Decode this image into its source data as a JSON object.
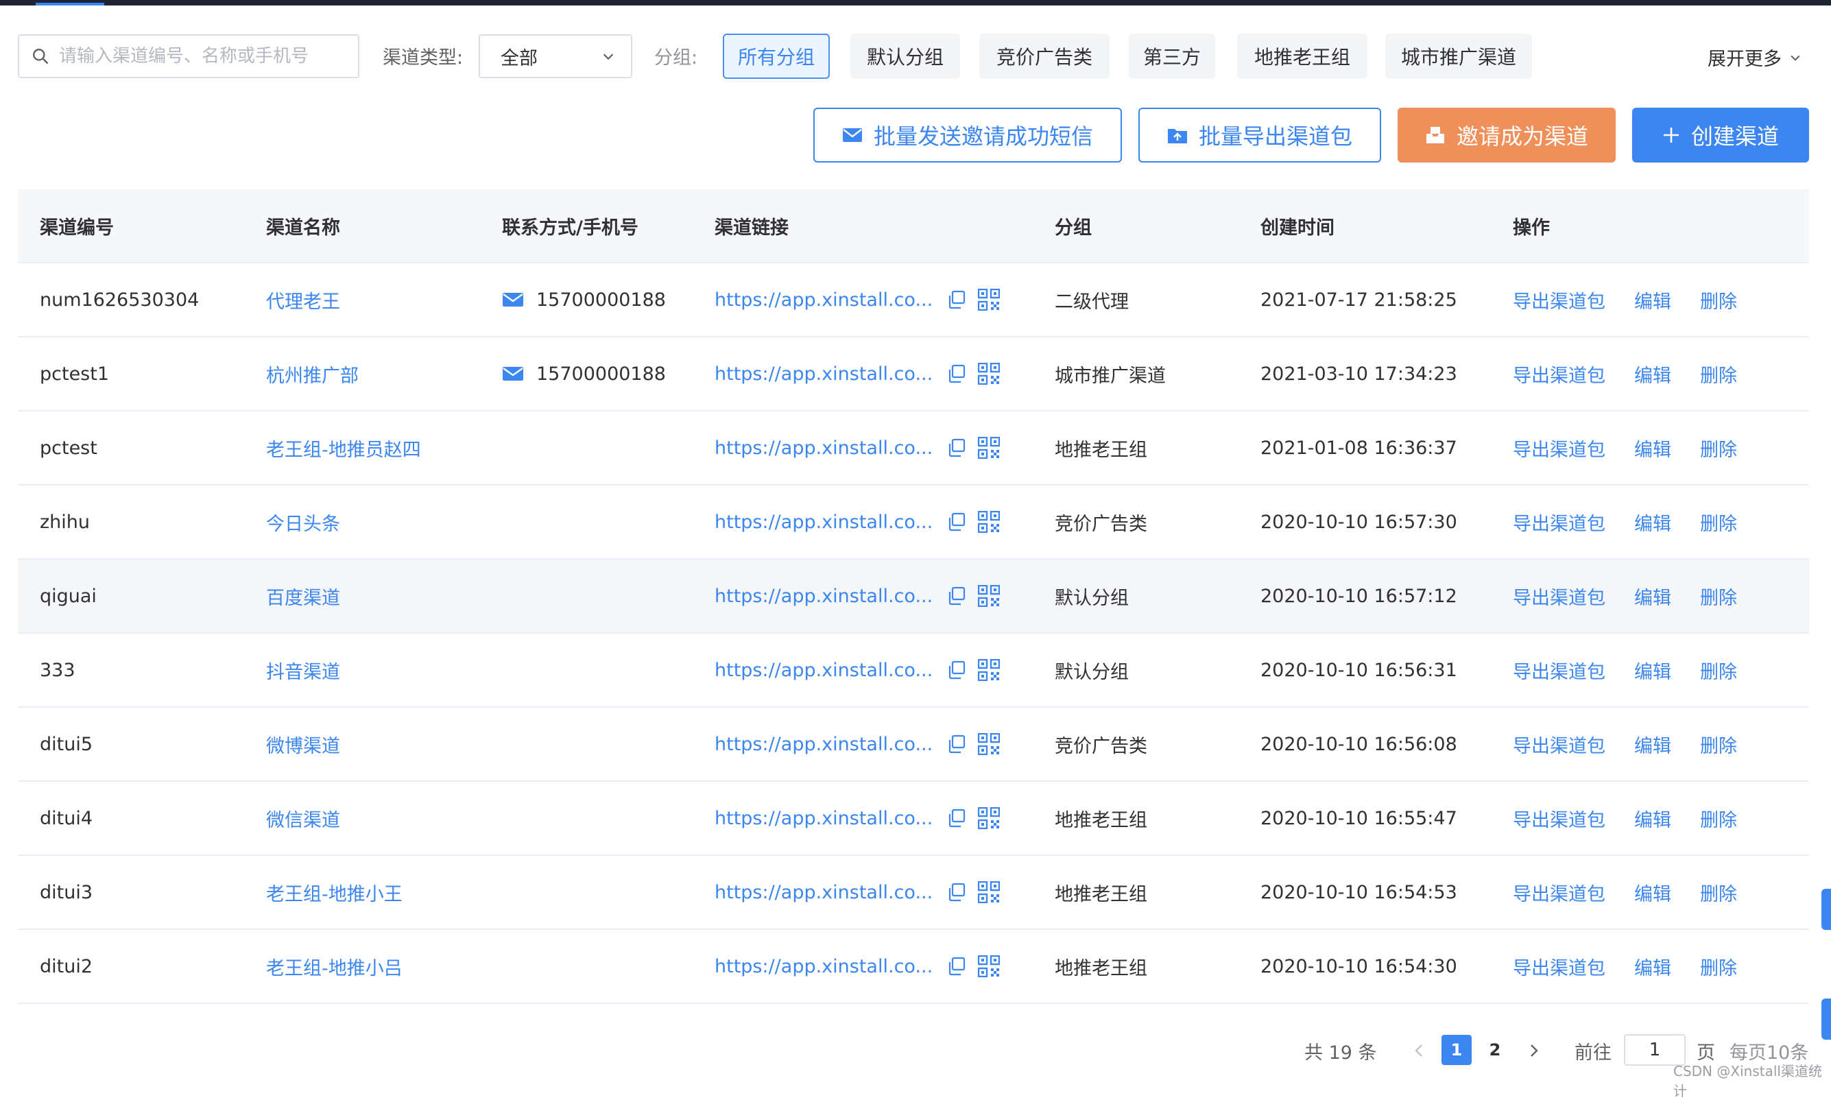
{
  "filters": {
    "search_placeholder": "请输入渠道编号、名称或手机号",
    "type_label": "渠道类型:",
    "type_value": "全部",
    "group_label": "分组:",
    "groups": [
      "所有分组",
      "默认分组",
      "竞价广告类",
      "第三方",
      "地推老王组",
      "城市推广渠道"
    ],
    "active_group": "所有分组",
    "more_label": "展开更多"
  },
  "actions": {
    "batch_sms": "批量发送邀请成功短信",
    "batch_export": "批量导出渠道包",
    "invite": "邀请成为渠道",
    "create": "创建渠道"
  },
  "table": {
    "headers": [
      "渠道编号",
      "渠道名称",
      "联系方式/手机号",
      "渠道链接",
      "分组",
      "创建时间",
      "操作"
    ],
    "op_labels": {
      "export": "导出渠道包",
      "edit": "编辑",
      "delete": "删除"
    },
    "rows": [
      {
        "id": "num1626530304",
        "name": "代理老王",
        "phone": "15700000188",
        "link": "https://app.xinstall.co...",
        "group": "二级代理",
        "created": "2021-07-17 21:58:25"
      },
      {
        "id": "pctest1",
        "name": "杭州推广部",
        "phone": "15700000188",
        "link": "https://app.xinstall.co...",
        "group": "城市推广渠道",
        "created": "2021-03-10 17:34:23"
      },
      {
        "id": "pctest",
        "name": "老王组-地推员赵四",
        "phone": "",
        "link": "https://app.xinstall.co...",
        "group": "地推老王组",
        "created": "2021-01-08 16:36:37"
      },
      {
        "id": "zhihu",
        "name": "今日头条",
        "phone": "",
        "link": "https://app.xinstall.co...",
        "group": "竞价广告类",
        "created": "2020-10-10 16:57:30"
      },
      {
        "id": "qiguai",
        "name": "百度渠道",
        "phone": "",
        "link": "https://app.xinstall.co...",
        "group": "默认分组",
        "created": "2020-10-10 16:57:12"
      },
      {
        "id": "333",
        "name": "抖音渠道",
        "phone": "",
        "link": "https://app.xinstall.co...",
        "group": "默认分组",
        "created": "2020-10-10 16:56:31"
      },
      {
        "id": "ditui5",
        "name": "微博渠道",
        "phone": "",
        "link": "https://app.xinstall.co...",
        "group": "竞价广告类",
        "created": "2020-10-10 16:56:08"
      },
      {
        "id": "ditui4",
        "name": "微信渠道",
        "phone": "",
        "link": "https://app.xinstall.co...",
        "group": "地推老王组",
        "created": "2020-10-10 16:55:47"
      },
      {
        "id": "ditui3",
        "name": "老王组-地推小王",
        "phone": "",
        "link": "https://app.xinstall.co...",
        "group": "地推老王组",
        "created": "2020-10-10 16:54:53"
      },
      {
        "id": "ditui2",
        "name": "老王组-地推小吕",
        "phone": "",
        "link": "https://app.xinstall.co...",
        "group": "地推老王组",
        "created": "2020-10-10 16:54:30"
      }
    ]
  },
  "pagination": {
    "total": "共 19 条",
    "pages": [
      "1",
      "2"
    ],
    "current": "1",
    "goto_label": "前往",
    "goto_value": "1",
    "page_unit": "页",
    "page_size": "每页10条"
  },
  "watermark": "CSDN @Xinstall渠道统计",
  "colors": {
    "primary": "#3b86f0",
    "orange": "#ef8f5a",
    "topbar": "#1e2432"
  }
}
